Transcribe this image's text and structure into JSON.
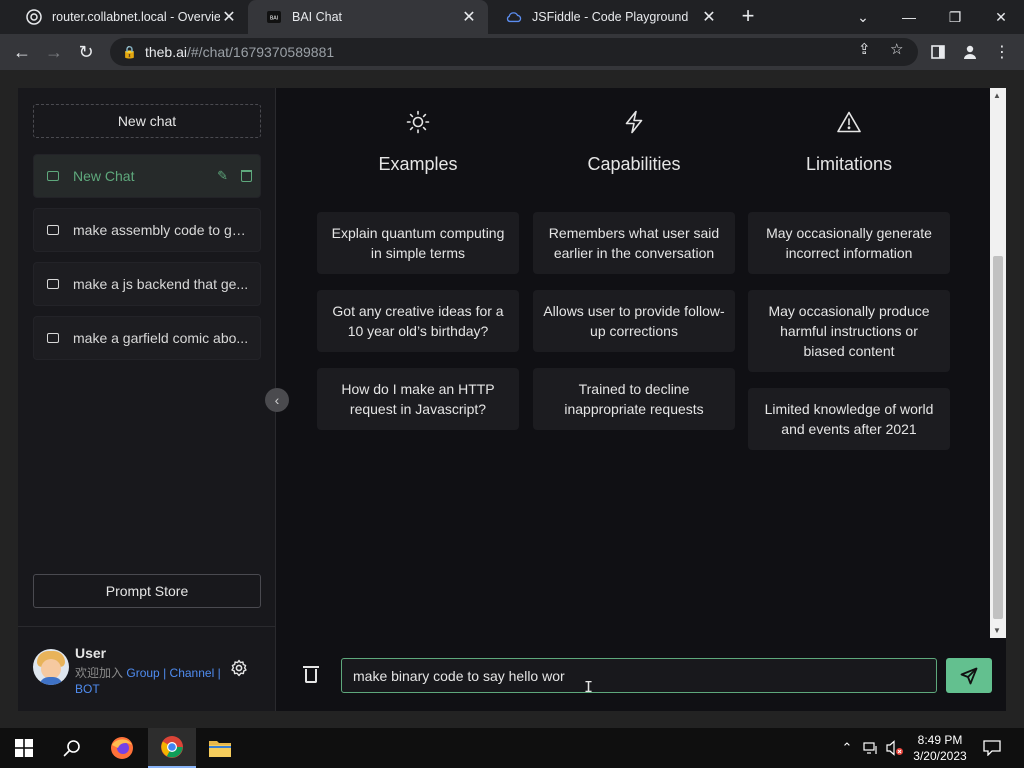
{
  "browser": {
    "tabs": [
      {
        "title": "router.collabnet.local - Overview",
        "active": false
      },
      {
        "title": "BAI Chat",
        "active": true
      },
      {
        "title": "JSFiddle - Code Playground",
        "active": false
      }
    ],
    "url_host": "theb.ai",
    "url_path": "/#/chat/1679370589881"
  },
  "sidebar": {
    "new_chat_label": "New chat",
    "chats": [
      {
        "label": "New Chat",
        "active": true
      },
      {
        "label": "make assembly code to ge...",
        "active": false
      },
      {
        "label": "make a js backend that ge...",
        "active": false
      },
      {
        "label": "make a garfield comic abo...",
        "active": false
      }
    ],
    "prompt_store_label": "Prompt Store",
    "user": {
      "name": "User",
      "welcome": "欢迎加入",
      "link_group": "Group",
      "link_channel": "Channel",
      "link_bot": "BOT",
      "separator": "|"
    }
  },
  "main": {
    "columns": [
      {
        "icon": "sun-icon",
        "title": "Examples",
        "cards": [
          "Explain quantum computing in simple terms",
          "Got any creative ideas for a 10 year old’s birthday?",
          "How do I make an HTTP request in Javascript?"
        ]
      },
      {
        "icon": "lightning-icon",
        "title": "Capabilities",
        "cards": [
          "Remembers what user said earlier in the conversation",
          "Allows user to provide follow-up corrections",
          "Trained to decline inappropriate requests"
        ]
      },
      {
        "icon": "warning-icon",
        "title": "Limitations",
        "cards": [
          "May occasionally generate incorrect information",
          "May occasionally produce harmful instructions or biased content",
          "Limited knowledge of world and events after 2021"
        ]
      }
    ],
    "input_value": "make binary code to say hello wor",
    "accent_color": "#63c08f"
  },
  "taskbar": {
    "time": "8:49 PM",
    "date": "3/20/2023"
  }
}
